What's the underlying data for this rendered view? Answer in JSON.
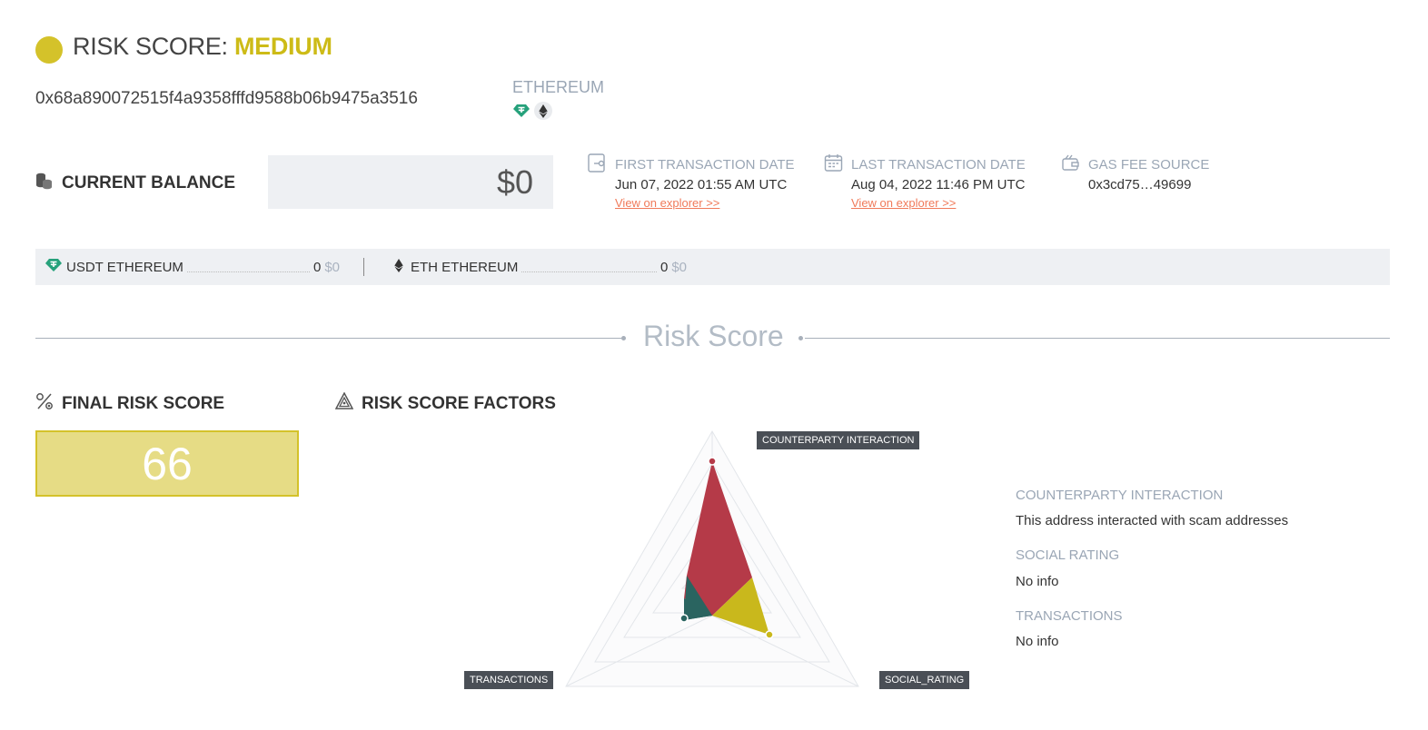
{
  "header": {
    "risk_prefix": "RISK SCORE:",
    "risk_level": "MEDIUM",
    "risk_color": "#d4c22a"
  },
  "wallet": {
    "address": "0x68a890072515f4a9358fffd9588b06b9475a3516",
    "chain": "ETHEREUM",
    "chain_icons": [
      "tether-icon",
      "ethereum-icon"
    ]
  },
  "balance": {
    "label": "CURRENT BALANCE",
    "value": "$0"
  },
  "info": {
    "first_tx": {
      "label": "FIRST TRANSACTION DATE",
      "value": "Jun 07, 2022 01:55 AM UTC",
      "link": "View on explorer >>"
    },
    "last_tx": {
      "label": "LAST TRANSACTION DATE",
      "value": "Aug 04, 2022 11:46 PM UTC",
      "link": "View on explorer >>"
    },
    "gas": {
      "label": "GAS FEE SOURCE",
      "value": "0x3cd75…49699"
    }
  },
  "tokens": [
    {
      "name": "USDT ETHEREUM",
      "amount": "0",
      "usd": "$0",
      "icon": "tether-icon"
    },
    {
      "name": "ETH ETHEREUM",
      "amount": "0",
      "usd": "$0",
      "icon": "ethereum-icon"
    }
  ],
  "section": {
    "title": "Risk Score"
  },
  "final_score": {
    "label": "FINAL RISK SCORE",
    "value": "66"
  },
  "factors": {
    "label": "RISK SCORE FACTORS",
    "axis_labels": {
      "top": "COUNTERPARTY INTERACTION",
      "left": "TRANSACTIONS",
      "right": "SOCIAL_RATING"
    },
    "items": [
      {
        "title": "COUNTERPARTY INTERACTION",
        "value": "This address interacted with scam addresses"
      },
      {
        "title": "SOCIAL RATING",
        "value": "No info"
      },
      {
        "title": "TRANSACTIONS",
        "value": "No info"
      }
    ],
    "colors": {
      "counterparty": "#b53a48",
      "social": "#c9b81c",
      "transactions": "#2a6460"
    }
  }
}
